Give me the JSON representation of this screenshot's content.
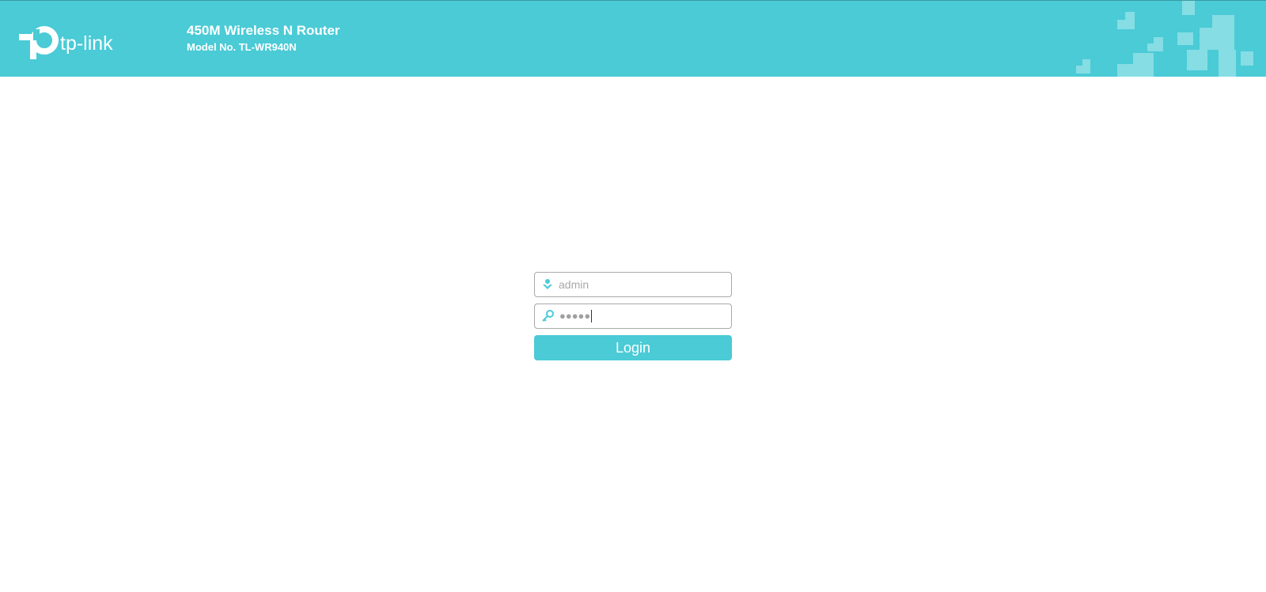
{
  "header": {
    "brand": "tp-link",
    "product_name": "450M Wireless N Router",
    "model": "Model No. TL-WR940N",
    "background_color": "#4acbd6"
  },
  "login": {
    "username": {
      "placeholder": "admin",
      "value": "",
      "icon": "user-icon"
    },
    "password": {
      "masked_value": "●●●●●",
      "icon": "key-icon"
    },
    "login_label": "Login"
  }
}
